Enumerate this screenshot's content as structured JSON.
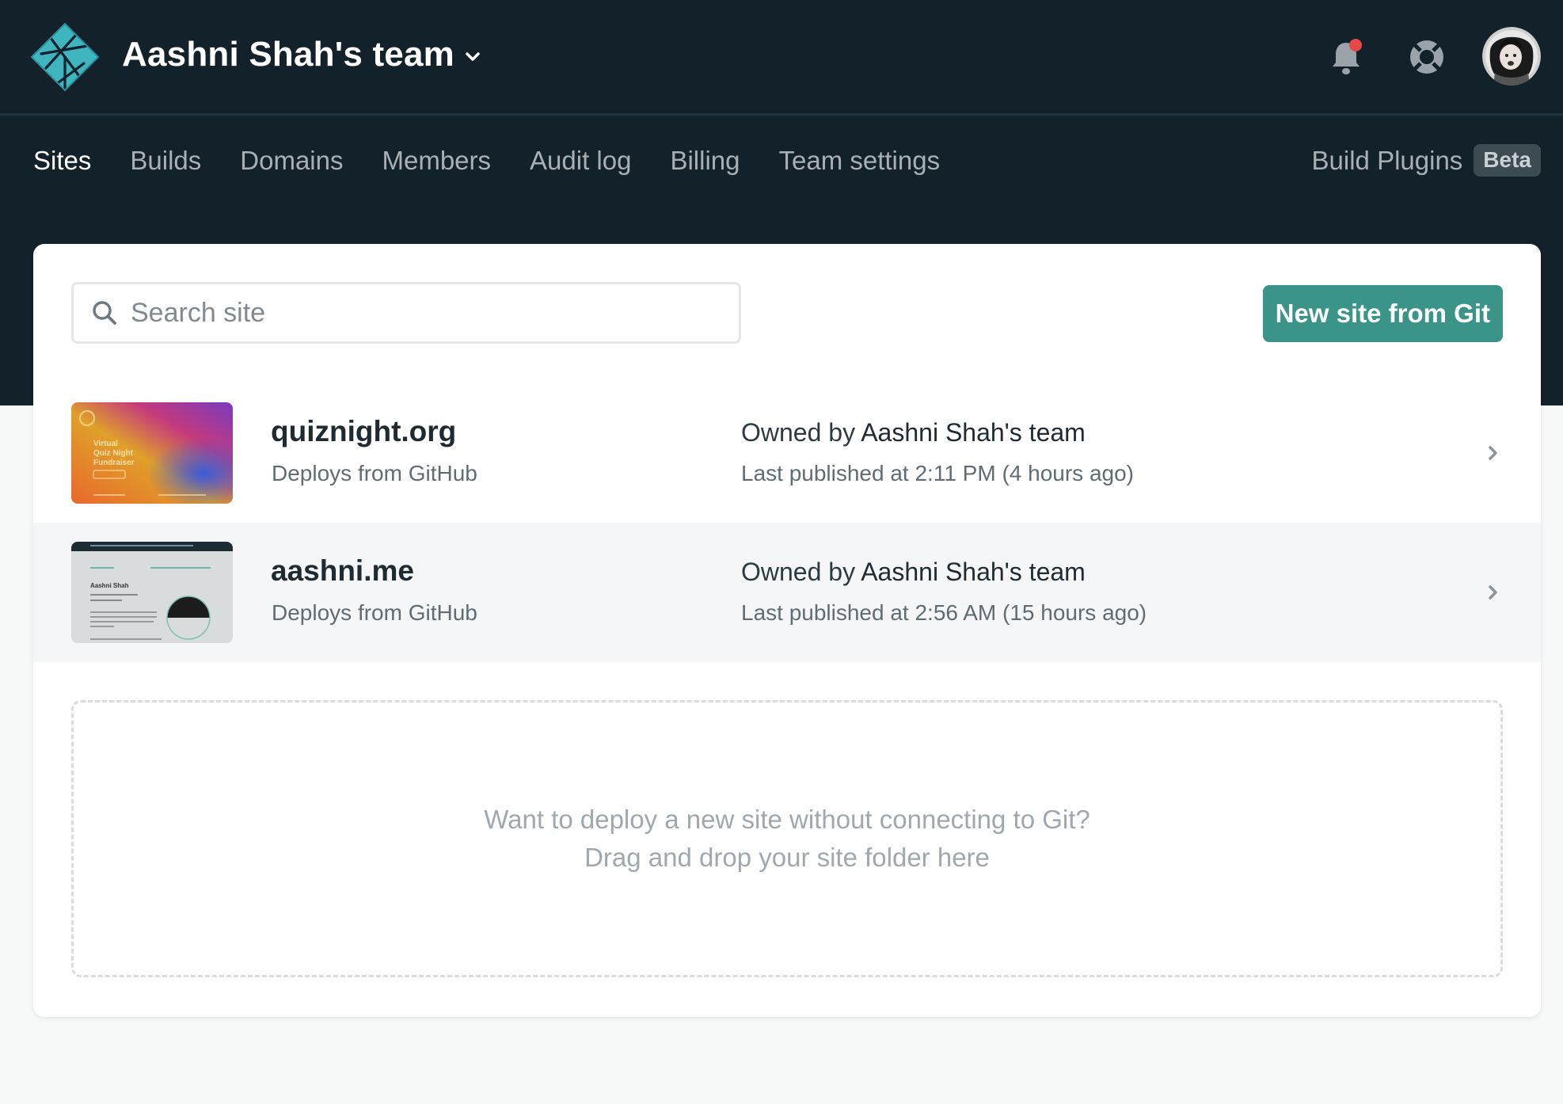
{
  "header": {
    "team_name": "Aashni Shah's team",
    "icons": [
      "netlify-logo-icon",
      "chevron-down-icon",
      "bell-icon",
      "lifebuoy-icon",
      "avatar"
    ]
  },
  "nav": {
    "items": [
      {
        "label": "Sites",
        "active": true
      },
      {
        "label": "Builds"
      },
      {
        "label": "Domains"
      },
      {
        "label": "Members"
      },
      {
        "label": "Audit log"
      },
      {
        "label": "Billing"
      },
      {
        "label": "Team settings"
      }
    ],
    "plugins_label": "Build Plugins",
    "beta_badge": "Beta"
  },
  "search": {
    "placeholder": "Search site",
    "value": ""
  },
  "new_site_button": "New site from Git",
  "sites": [
    {
      "name": "quiznight.org",
      "deploy": "Deploys from GitHub",
      "owner_prefix": "Owned by",
      "owner": "Aashni Shah's team",
      "published": "Last published at 2:11 PM (4 hours ago)",
      "thumbnail": {
        "line1": "Virtual",
        "line2": "Quiz Night",
        "line3": "Fundraiser"
      }
    },
    {
      "name": "aashni.me",
      "deploy": "Deploys from GitHub",
      "owner_prefix": "Owned by",
      "owner": "Aashni Shah's team",
      "published": "Last published at 2:56 AM (15 hours ago)",
      "thumbnail": {
        "heading": "Aashni Shah"
      }
    }
  ],
  "dropzone": {
    "line1": "Want to deploy a new site without connecting to Git?",
    "line2": "Drag and drop your site folder here"
  },
  "colors": {
    "header_bg": "#13212a",
    "accent": "#3b9488",
    "notification_dot": "#e64848"
  }
}
